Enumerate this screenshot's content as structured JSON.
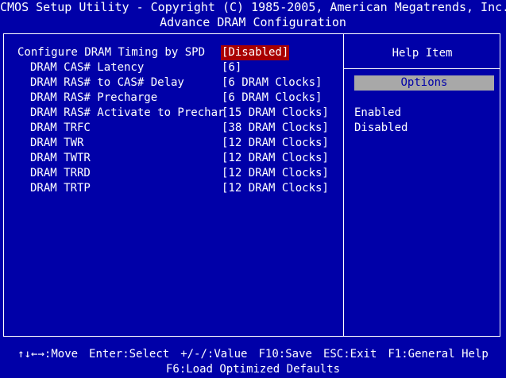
{
  "header": {
    "utility_title": "CMOS Setup Utility - Copyright (C) 1985-2005, American Megatrends, Inc.",
    "page_title": "Advance DRAM Configuration"
  },
  "settings": [
    {
      "label": "Configure DRAM Timing by SPD",
      "value": "[Disabled]"
    },
    {
      "label": "DRAM CAS# Latency",
      "value": "[6]"
    },
    {
      "label": "DRAM RAS# to CAS# Delay",
      "value": "[6 DRAM Clocks]"
    },
    {
      "label": "DRAM RAS# Precharge",
      "value": "[6 DRAM Clocks]"
    },
    {
      "label": "DRAM RAS# Activate to Prechar",
      "value": "[15 DRAM Clocks]"
    },
    {
      "label": "DRAM TRFC",
      "value": "[38 DRAM Clocks]"
    },
    {
      "label": "DRAM TWR",
      "value": "[12 DRAM Clocks]"
    },
    {
      "label": "DRAM TWTR",
      "value": "[12 DRAM Clocks]"
    },
    {
      "label": "DRAM TRRD",
      "value": "[12 DRAM Clocks]"
    },
    {
      "label": "DRAM TRTP",
      "value": "[12 DRAM Clocks]"
    }
  ],
  "help": {
    "title": "Help Item",
    "options_label": "Options",
    "options": [
      "Enabled",
      "Disabled"
    ]
  },
  "footer": {
    "keys": [
      "↑↓←→:Move",
      "Enter:Select",
      "+/-/:Value",
      "F10:Save",
      "ESC:Exit",
      "F1:General Help"
    ],
    "extra": "F6:Load Optimized Defaults"
  },
  "colors": {
    "background": "#0000a8",
    "text": "#ffffff",
    "selected_value_bg": "#a80000",
    "options_bar_bg": "#a8a8a8"
  }
}
